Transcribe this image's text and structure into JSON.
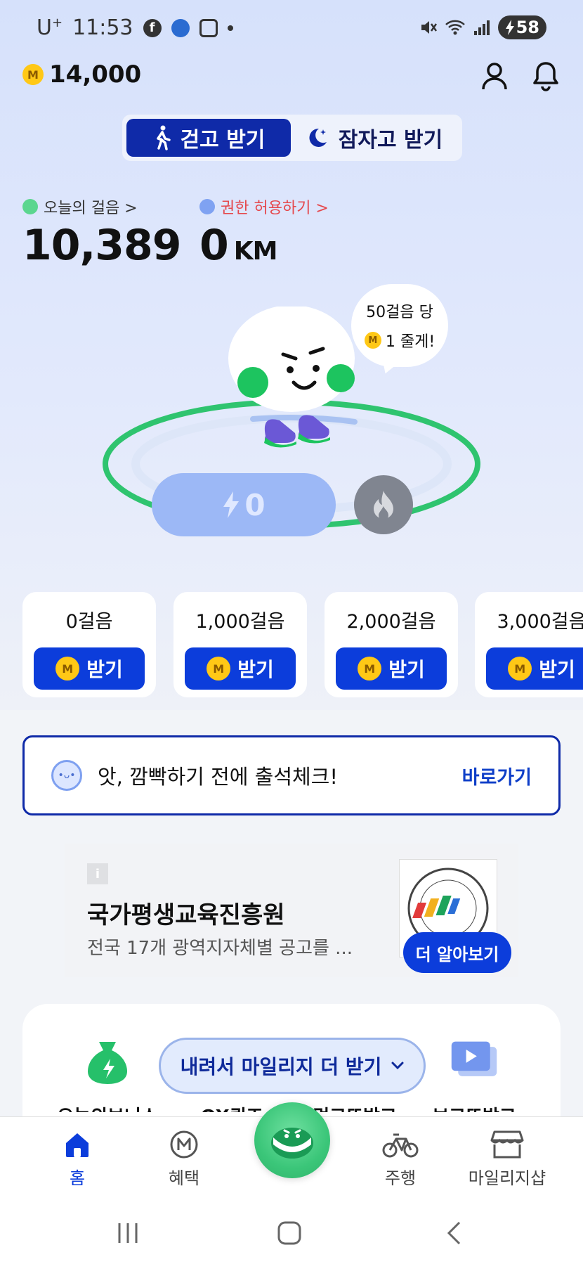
{
  "status_bar": {
    "carrier": "U",
    "carrier_sup": "+",
    "time": "11:53",
    "battery": "58"
  },
  "header": {
    "points": "14,000",
    "coin_symbol": "M"
  },
  "mode_tabs": [
    {
      "label": "걷고 받기",
      "icon": "walking-person-icon",
      "active": true
    },
    {
      "label": "잠자고 받기",
      "icon": "moon-icon",
      "active": false
    }
  ],
  "stats": {
    "steps_label": "오늘의 걸음 >",
    "steps_value": "10,389",
    "steps_dot_color": "#5bd68f",
    "permission_label": "권한 허용하기 >",
    "permission_color": "#e5484d",
    "distance_value": "0",
    "distance_unit": "KM",
    "distance_dot_color": "#7fa2f2"
  },
  "character": {
    "bubble_line1": "50걸음 당",
    "bubble_line2": "1 줄게!",
    "energy_value": "0",
    "ring_color": "#2fc46f"
  },
  "milestones": [
    {
      "label": "0걸음",
      "button": "받기"
    },
    {
      "label": "1,000걸음",
      "button": "받기"
    },
    {
      "label": "2,000걸음",
      "button": "받기"
    },
    {
      "label": "3,000걸음",
      "button": "받기"
    }
  ],
  "attendance": {
    "text": "앗, 깜빡하기 전에 출석체크!",
    "link": "바로가기"
  },
  "ad": {
    "info": "i",
    "title": "국가평생교육진흥원",
    "description": "전국 17개 광역지자체별 공고를 ...",
    "button": "더 알아보기"
  },
  "services": [
    {
      "label": "오늘의보너스"
    },
    {
      "label": "OX퀴즈"
    },
    {
      "label": "먹고또받고"
    },
    {
      "label": "보고또받고"
    }
  ],
  "more_pill": "내려서 마일리지 더 받기",
  "bottom_nav": [
    {
      "label": "홈",
      "icon": "home-icon",
      "active": true
    },
    {
      "label": "혜택",
      "icon": "mileage-icon",
      "active": false
    },
    {
      "label": "주행",
      "icon": "bicycle-icon",
      "active": false
    },
    {
      "label": "마일리지샵",
      "icon": "shop-icon",
      "active": false
    }
  ],
  "colors": {
    "brand_blue": "#0c3ddb",
    "navy": "#0f2aa8",
    "coin_yellow": "#ffc816"
  }
}
